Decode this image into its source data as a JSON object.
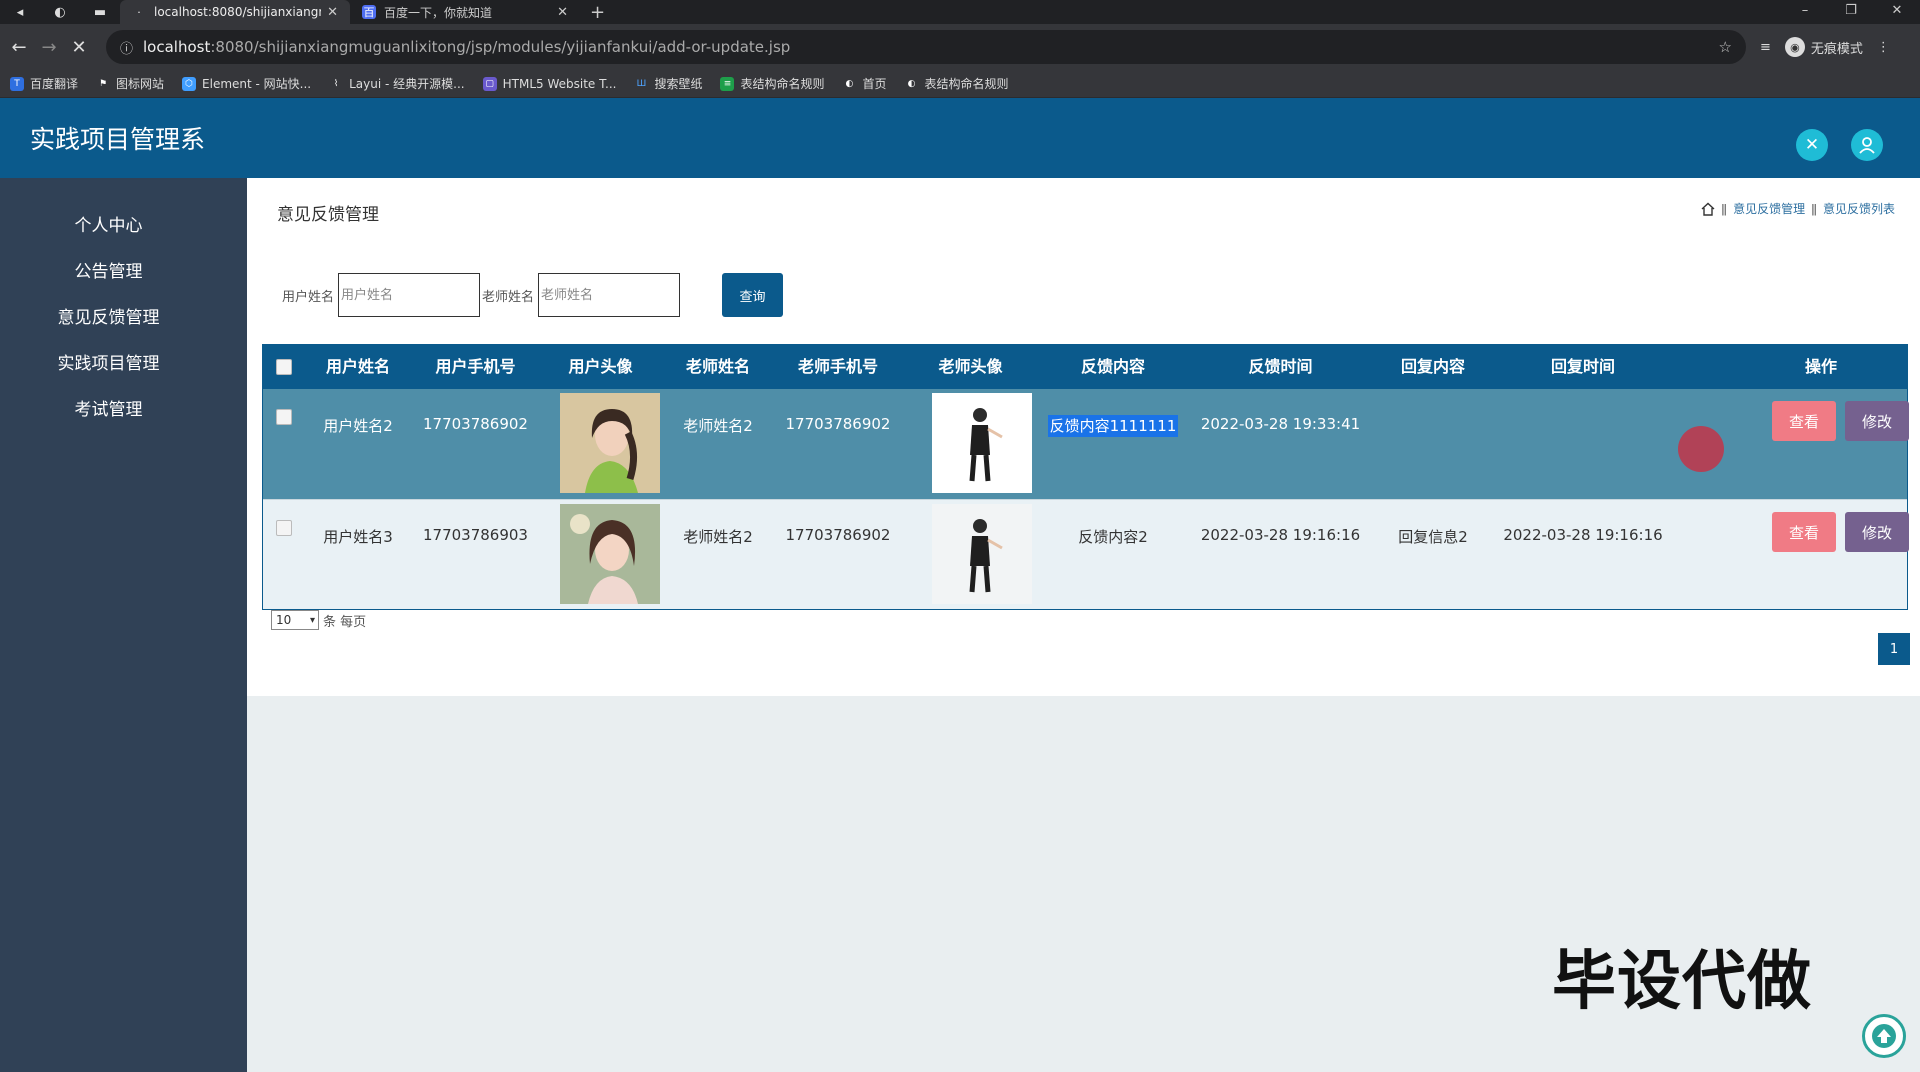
{
  "browser": {
    "tabs": [
      {
        "label": "localhost:8080/shijianxiangmu",
        "active": true
      },
      {
        "label": "百度一下，你就知道",
        "active": false
      }
    ],
    "url_host": "localhost",
    "url_rest": ":8080/shijianxiangmuguanlixitong/jsp/modules/yijianfankui/add-or-update.jsp",
    "incognito_label": "无痕模式",
    "bookmarks": [
      "百度翻译",
      "图标网站",
      "Element - 网站快...",
      "Layui - 经典开源模...",
      "HTML5 Website T...",
      "搜索壁纸",
      "表结构命名规则",
      "首页",
      "表结构命名规则"
    ]
  },
  "app": {
    "title": "实践项目管理系"
  },
  "sidebar": {
    "items": [
      "个人中心",
      "公告管理",
      "意见反馈管理",
      "实践项目管理",
      "考试管理"
    ]
  },
  "page": {
    "title": "意见反馈管理",
    "breadcrumb": [
      "意见反馈管理",
      "意见反馈列表"
    ]
  },
  "search": {
    "user_label": "用户姓名",
    "user_placeholder": "用户姓名",
    "teacher_label": "老师姓名",
    "teacher_placeholder": "老师姓名",
    "query_label": "查询"
  },
  "table": {
    "headers": [
      "用户姓名",
      "用户手机号",
      "用户头像",
      "老师姓名",
      "老师手机号",
      "老师头像",
      "反馈内容",
      "反馈时间",
      "回复内容",
      "回复时间",
      "操作"
    ],
    "rows": [
      {
        "user": "用户姓名2",
        "phone": "17703786902",
        "teacher": "老师姓名2",
        "tphone": "17703786902",
        "content": "反馈内容1111111",
        "time": "2022-03-28 19:33:41",
        "reply": "",
        "reply_time": ""
      },
      {
        "user": "用户姓名3",
        "phone": "17703786903",
        "teacher": "老师姓名2",
        "tphone": "17703786902",
        "content": "反馈内容2",
        "time": "2022-03-28 19:16:16",
        "reply": "回复信息2",
        "reply_time": "2022-03-28 19:16:16"
      }
    ],
    "view_label": "查看",
    "edit_label": "修改"
  },
  "pager": {
    "size": "10",
    "size_suffix": "条 每页",
    "current": "1"
  },
  "watermark": "毕设代做",
  "colors": {
    "header": "#0b5a8c",
    "sidebar": "#304156",
    "view_button": "#f07b85",
    "edit_button": "#75618f"
  }
}
